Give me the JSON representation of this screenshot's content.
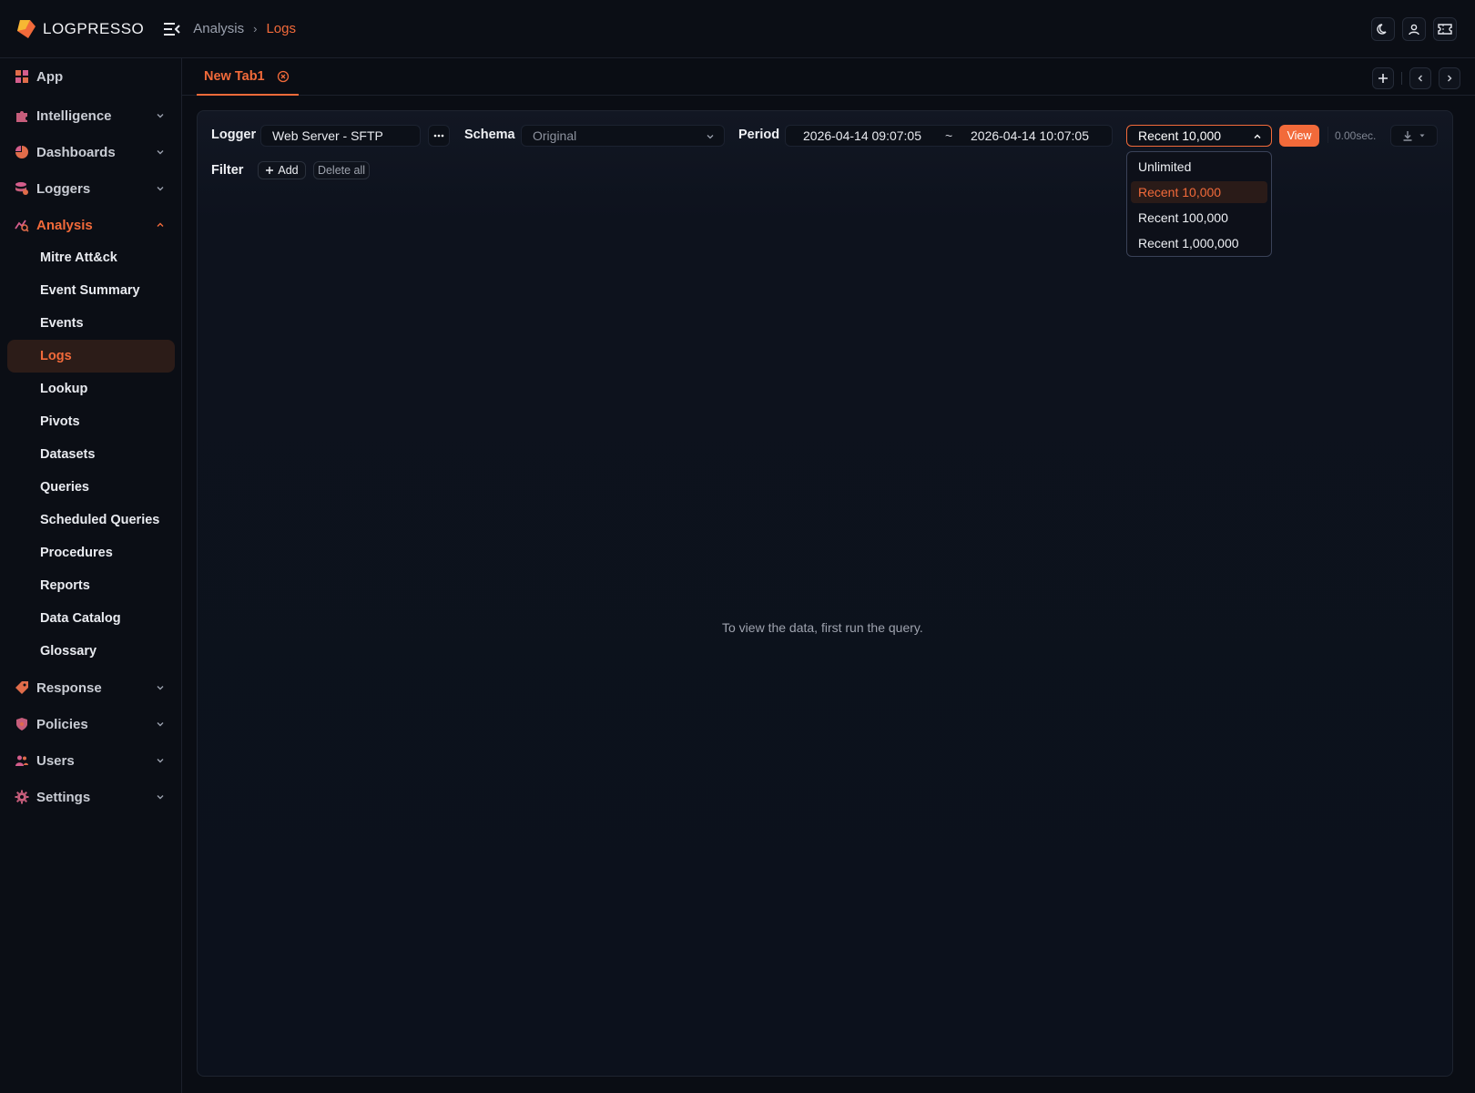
{
  "app": {
    "name": "LOGPRESSO"
  },
  "breadcrumb": [
    "Analysis",
    "Logs"
  ],
  "sidebar": {
    "items": [
      {
        "label": "App",
        "icon": "grid-icon"
      },
      {
        "label": "Intelligence",
        "icon": "puzzle-icon"
      },
      {
        "label": "Dashboards",
        "icon": "pie-chart-icon"
      },
      {
        "label": "Loggers",
        "icon": "database-icon"
      },
      {
        "label": "Analysis",
        "icon": "analytics-icon"
      },
      {
        "label": "Response",
        "icon": "tag-icon"
      },
      {
        "label": "Policies",
        "icon": "shield-icon"
      },
      {
        "label": "Users",
        "icon": "users-icon"
      },
      {
        "label": "Settings",
        "icon": "gear-icon"
      }
    ],
    "analysis_sub": [
      "Mitre Att&ck",
      "Event Summary",
      "Events",
      "Logs",
      "Lookup",
      "Pivots",
      "Datasets",
      "Queries",
      "Scheduled Queries",
      "Procedures",
      "Reports",
      "Data Catalog",
      "Glossary"
    ],
    "active_sub": "Logs"
  },
  "tabs": [
    {
      "label": "New Tab1",
      "active": true
    }
  ],
  "query": {
    "logger_label": "Logger",
    "logger_value": "Web Server - SFTP",
    "schema_label": "Schema",
    "schema_value": "Original",
    "period_label": "Period",
    "period_from": "2026-04-14 09:07:05",
    "period_sep": "~",
    "period_to": "2026-04-14 10:07:05",
    "limit_value": "Recent 10,000",
    "limit_options": [
      "Unlimited",
      "Recent 10,000",
      "Recent 100,000",
      "Recent 1,000,000"
    ],
    "view_label": "View",
    "elapsed": "0.00sec.",
    "filter_label": "Filter",
    "add_label": "Add",
    "delete_all_label": "Delete all"
  },
  "empty_message": "To view the data, first run the query.",
  "colors": {
    "accent": "#f26a3a",
    "background": "#0a0d14",
    "panel": "#0d121d"
  }
}
